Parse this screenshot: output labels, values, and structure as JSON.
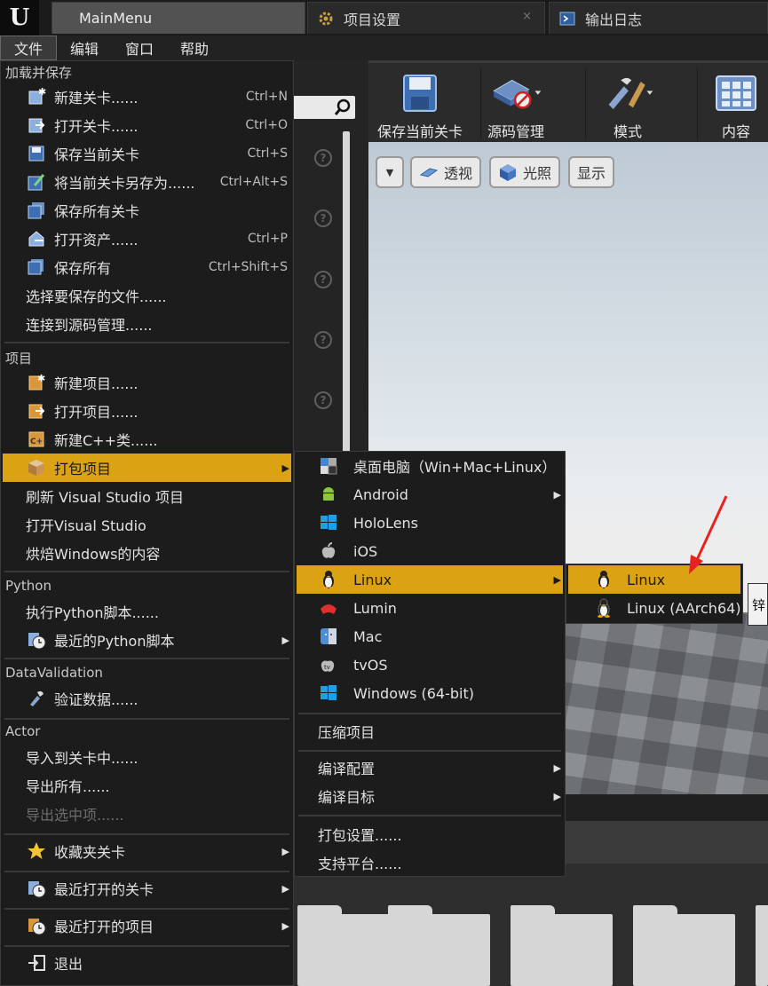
{
  "tabs": [
    {
      "label": "MainMenu",
      "icon": "unreal-logo-icon"
    },
    {
      "label": "项目设置",
      "icon": "gear-icon",
      "close": "×"
    },
    {
      "label": "输出日志",
      "icon": "console-icon"
    }
  ],
  "menubar": {
    "items": [
      "文件",
      "编辑",
      "窗口",
      "帮助"
    ]
  },
  "toolbar": {
    "buttons": [
      "保存当前关卡",
      "源码管理",
      "模式",
      "内容"
    ]
  },
  "viewport": {
    "buttons": [
      "透视",
      "光照",
      "显示"
    ]
  },
  "file_menu": {
    "sections": [
      {
        "header": "加载并保存",
        "items": [
          {
            "label": "新建关卡......",
            "shortcut": "Ctrl+N",
            "icon": "new-level-icon"
          },
          {
            "label": "打开关卡......",
            "shortcut": "Ctrl+O",
            "icon": "open-level-icon"
          },
          {
            "label": "保存当前关卡",
            "shortcut": "Ctrl+S",
            "icon": "save-icon"
          },
          {
            "label": "将当前关卡另存为......",
            "shortcut": "Ctrl+Alt+S",
            "icon": "save-as-icon"
          },
          {
            "label": "保存所有关卡",
            "shortcut": "",
            "icon": "save-all-levels-icon"
          },
          {
            "label": "打开资产......",
            "shortcut": "Ctrl+P",
            "icon": "open-asset-icon"
          },
          {
            "label": "保存所有",
            "shortcut": "Ctrl+Shift+S",
            "icon": "save-all-icon"
          },
          {
            "label": "选择要保存的文件......",
            "shortcut": ""
          },
          {
            "label": "连接到源码管理......",
            "shortcut": ""
          }
        ]
      },
      {
        "header": "项目",
        "items": [
          {
            "label": "新建项目......",
            "icon": "new-project-icon"
          },
          {
            "label": "打开项目......",
            "icon": "open-project-icon"
          },
          {
            "label": "新建C++类......",
            "icon": "cpp-class-icon"
          },
          {
            "label": "打包项目",
            "icon": "package-icon",
            "submenu": true,
            "highlighted": true
          },
          {
            "label": "刷新 Visual Studio 项目"
          },
          {
            "label": "打开Visual Studio"
          },
          {
            "label": "烘焙Windows的内容"
          }
        ]
      },
      {
        "header": "Python",
        "items": [
          {
            "label": "执行Python脚本......"
          },
          {
            "label": "最近的Python脚本",
            "icon": "recent-icon",
            "submenu": true
          }
        ]
      },
      {
        "header": "DataValidation",
        "items": [
          {
            "label": "验证数据......",
            "icon": "validate-icon"
          }
        ]
      },
      {
        "header": "Actor",
        "items": [
          {
            "label": "导入到关卡中......"
          },
          {
            "label": "导出所有......"
          },
          {
            "label": "导出选中项......",
            "disabled": true
          }
        ]
      }
    ],
    "bottom": [
      {
        "label": "收藏夹关卡",
        "icon": "star-icon",
        "submenu": true
      },
      {
        "label": "最近打开的关卡",
        "icon": "recent-levels-icon",
        "submenu": true
      },
      {
        "label": "最近打开的项目",
        "icon": "recent-projects-icon",
        "submenu": true
      },
      {
        "label": "退出",
        "icon": "exit-icon"
      }
    ]
  },
  "package_menu": {
    "platforms": [
      {
        "label": "桌面电脑（Win+Mac+Linux）",
        "icon": "desktop-icon"
      },
      {
        "label": "Android",
        "icon": "android-icon",
        "submenu": true
      },
      {
        "label": "HoloLens",
        "icon": "windows-icon"
      },
      {
        "label": "iOS",
        "icon": "apple-icon"
      },
      {
        "label": "Linux",
        "icon": "linux-icon",
        "submenu": true,
        "highlighted": true
      },
      {
        "label": "Lumin",
        "icon": "lumin-icon"
      },
      {
        "label": "Mac",
        "icon": "mac-icon"
      },
      {
        "label": "tvOS",
        "icon": "tvos-icon"
      },
      {
        "label": "Windows (64-bit)",
        "icon": "windows-icon"
      }
    ],
    "compress": "压缩项目",
    "build_config": "编译配置",
    "build_target": "编译目标",
    "package_settings": "打包设置......",
    "supported_platforms": "支持平台......"
  },
  "linux_menu": {
    "items": [
      {
        "label": "Linux",
        "icon": "linux-icon",
        "highlighted": true
      },
      {
        "label": "Linux (AArch64)",
        "icon": "linux-icon"
      }
    ]
  },
  "tooltip_fragment": "锌",
  "colors": {
    "highlight": "#dba213",
    "menu_bg": "#1c1c1c",
    "annotation_arrow": "#e8231c"
  }
}
